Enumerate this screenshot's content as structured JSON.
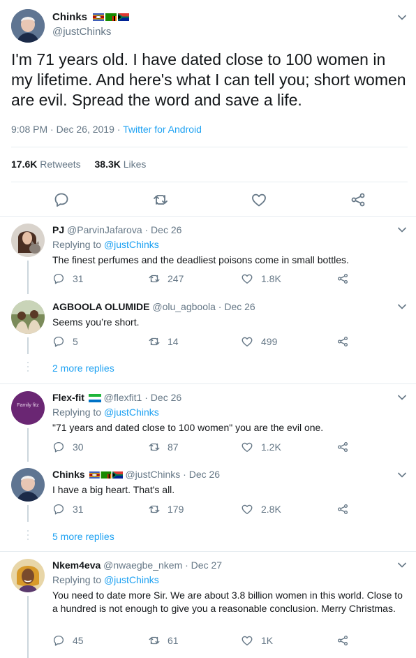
{
  "main_tweet": {
    "display_name": "Chinks",
    "handle": "@justChinks",
    "text": "I'm 71 years old. I have dated close to 100 women in my lifetime. And here's what I can tell you; short women are evil. Spread the word and save a life.",
    "time": "9:08 PM",
    "sep1": "·",
    "date": "Dec 26, 2019",
    "sep2": "·",
    "source": "Twitter for Android",
    "retweets_count": "17.6K",
    "retweets_label": "Retweets",
    "likes_count": "38.3K",
    "likes_label": "Likes"
  },
  "replies": [
    {
      "display_name": "PJ",
      "handle": "@ParvinJafarova",
      "date": "· Dec 26",
      "replying_prefix": "Replying to",
      "replying_to": "@justChinks",
      "text": "The finest perfumes and the deadliest poisons come in small bottles.",
      "replies": "31",
      "retweets": "247",
      "likes": "1.8K"
    },
    {
      "display_name": "AGBOOLA OLUMIDE",
      "handle": "@olu_agboola",
      "date": "· Dec 26",
      "text": "Seems you’re short.",
      "replies": "5",
      "retweets": "14",
      "likes": "499"
    },
    {
      "display_name": "Flex-fit",
      "handle": "@flexfit1",
      "date": "· Dec 26",
      "avatar_text": "Family fitz",
      "replying_prefix": "Replying to",
      "replying_to": "@justChinks",
      "text": "\"71 years and dated close to 100 women\" you are the evil one.",
      "replies": "30",
      "retweets": "87",
      "likes": "1.2K"
    },
    {
      "display_name": "Chinks",
      "handle": "@justChinks",
      "date": "· Dec 26",
      "text": "I have a big heart. That's all.",
      "replies": "31",
      "retweets": "179",
      "likes": "2.8K"
    },
    {
      "display_name": "Nkem4eva",
      "handle": "@nwaegbe_nkem",
      "date": "· Dec 27",
      "replying_prefix": "Replying to",
      "replying_to": "@justChinks",
      "text": "You need to date more Sir. We are about 3.8 billion women in this world. Close to a hundred is not enough to give you a reasonable conclusion. Merry Christmas.",
      "replies": "45",
      "retweets": "61",
      "likes": "1K"
    }
  ],
  "more_replies": [
    "2 more replies",
    "5 more replies"
  ],
  "colors": {
    "link": "#1da1f2",
    "muted": "#657786",
    "text": "#14171a",
    "border": "#e6ecf0"
  }
}
